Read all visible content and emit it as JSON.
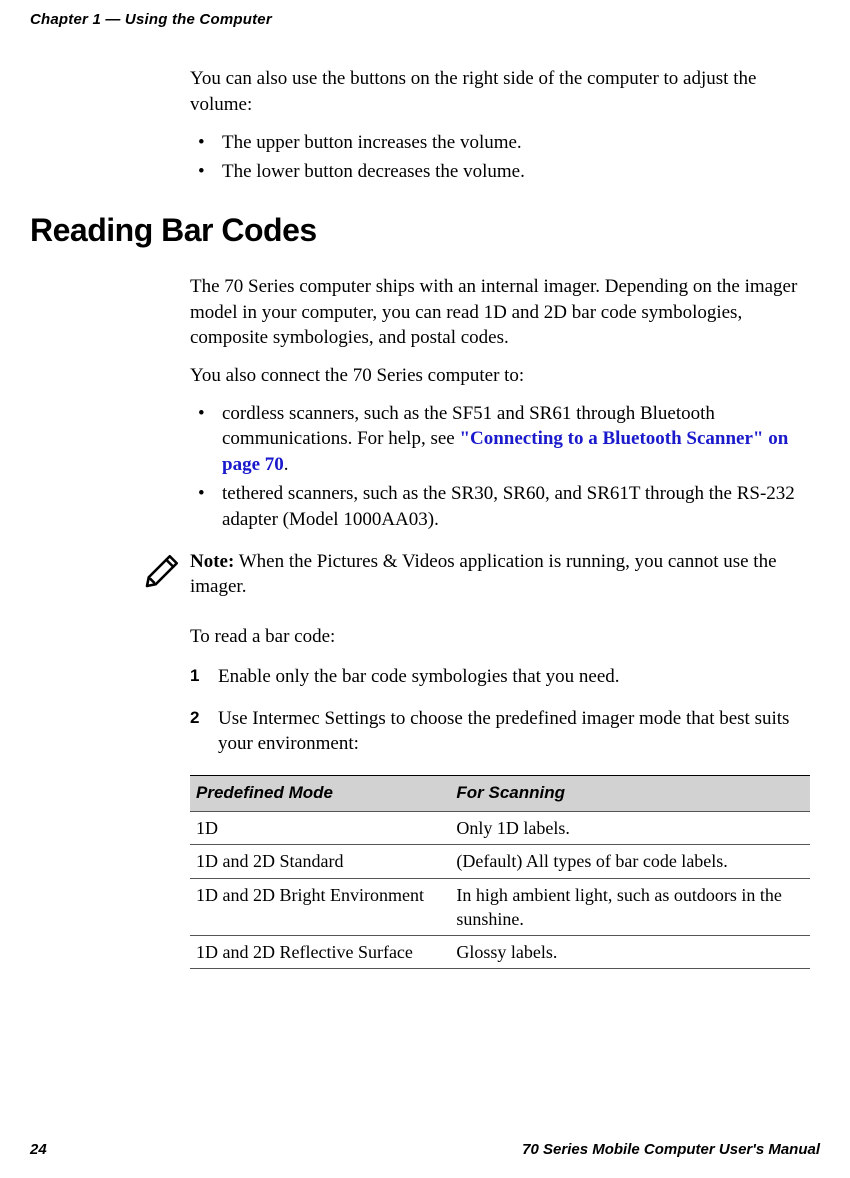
{
  "header": {
    "running": "Chapter 1 — Using the Computer"
  },
  "intro": "You can also use the buttons on the right side of the computer to adjust the volume:",
  "volume_bullets": [
    "The upper button increases the volume.",
    "The lower button decreases the volume."
  ],
  "section_heading": "Reading Bar Codes",
  "para_imager": "The 70 Series computer ships with an internal imager. Depending on the imager model in your computer, you can read 1D and 2D bar code symbologies, composite symbologies, and postal codes.",
  "para_connect": "You also connect the 70 Series computer to:",
  "connect_bullets": {
    "b1_pre": "cordless scanners, such as the SF51 and SR61 through Bluetooth communications. For help, see ",
    "b1_link": "\"Connecting to a Bluetooth Scanner\" on page 70",
    "b1_post": ".",
    "b2": "tethered scanners, such as the SR30, SR60, and SR61T through the RS-232 adapter (Model 1000AA03)."
  },
  "note": {
    "label": "Note:",
    "text": "  When the Pictures & Videos application is running, you cannot use the imager."
  },
  "to_read": "To read a bar code:",
  "steps": [
    "Enable only the bar code symbologies that you need.",
    "Use Intermec Settings to choose the predefined imager mode that best suits your environment:"
  ],
  "table": {
    "head": {
      "c1": "Predefined Mode",
      "c2": "For Scanning"
    },
    "rows": [
      {
        "c1": "1D",
        "c2": "Only 1D labels."
      },
      {
        "c1": "1D and 2D Standard",
        "c2": "(Default) All types of bar code labels."
      },
      {
        "c1": "1D and 2D Bright Environment",
        "c2": "In high ambient light, such as outdoors in the sunshine."
      },
      {
        "c1": "1D and 2D Reflective Surface",
        "c2": "Glossy labels."
      }
    ]
  },
  "footer": {
    "page": "24",
    "manual": "70 Series Mobile Computer User's Manual"
  }
}
